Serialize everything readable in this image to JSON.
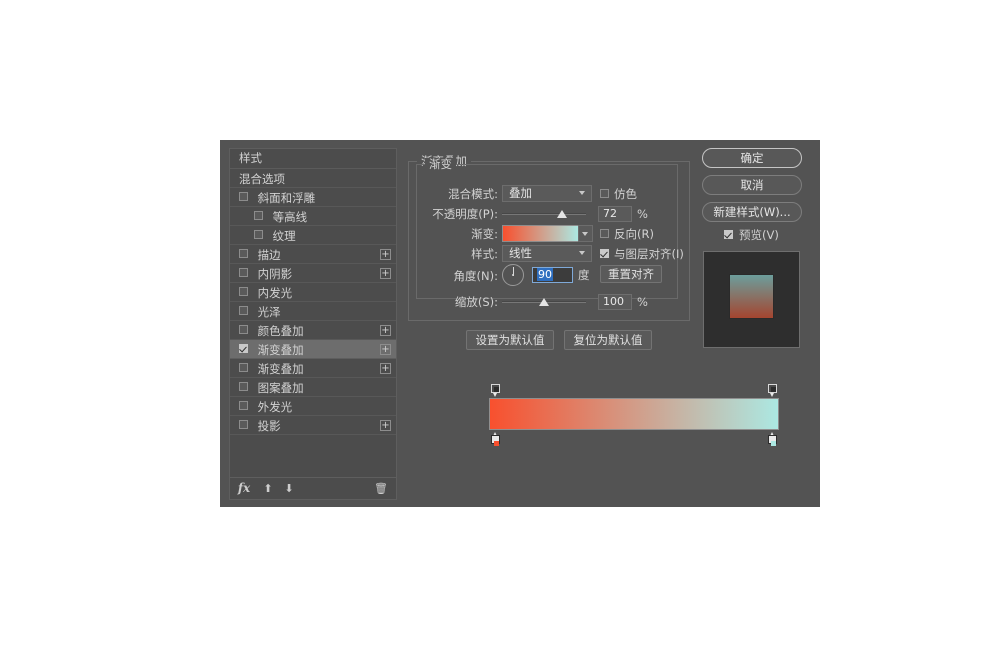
{
  "dialog": {
    "styles_panel": {
      "header": "样式",
      "blend_options": "混合选项",
      "items": [
        {
          "label": "斜面和浮雕",
          "checked": false,
          "indent": false,
          "plus": false,
          "selected": false
        },
        {
          "label": "等高线",
          "checked": false,
          "indent": true,
          "plus": false,
          "selected": false
        },
        {
          "label": "纹理",
          "checked": false,
          "indent": true,
          "plus": false,
          "selected": false
        },
        {
          "label": "描边",
          "checked": false,
          "indent": false,
          "plus": true,
          "selected": false
        },
        {
          "label": "内阴影",
          "checked": false,
          "indent": false,
          "plus": true,
          "selected": false
        },
        {
          "label": "内发光",
          "checked": false,
          "indent": false,
          "plus": false,
          "selected": false
        },
        {
          "label": "光泽",
          "checked": false,
          "indent": false,
          "plus": false,
          "selected": false
        },
        {
          "label": "颜色叠加",
          "checked": false,
          "indent": false,
          "plus": true,
          "selected": false
        },
        {
          "label": "渐变叠加",
          "checked": true,
          "indent": false,
          "plus": true,
          "selected": true
        },
        {
          "label": "渐变叠加",
          "checked": false,
          "indent": false,
          "plus": true,
          "selected": false
        },
        {
          "label": "图案叠加",
          "checked": false,
          "indent": false,
          "plus": false,
          "selected": false
        },
        {
          "label": "外发光",
          "checked": false,
          "indent": false,
          "plus": false,
          "selected": false
        },
        {
          "label": "投影",
          "checked": false,
          "indent": false,
          "plus": true,
          "selected": false
        }
      ],
      "toolbar": {
        "fx_icon": "fx-icon",
        "up_icon": "arrow-up-icon",
        "down_icon": "arrow-down-icon",
        "trash_icon": "trash-icon",
        "up_glyph": "⬆",
        "down_glyph": "⬇",
        "trash_glyph": "🗑",
        "fx_label": "fx"
      }
    },
    "main_panel": {
      "section_title": "渐变叠加",
      "group_title": "渐变",
      "blend_mode": {
        "label": "混合模式:",
        "value": "叠加"
      },
      "dither": {
        "label": "仿色",
        "checked": false
      },
      "opacity": {
        "label": "不透明度(P):",
        "value": "72",
        "unit": "%",
        "percent": 72
      },
      "gradient": {
        "label": "渐变:"
      },
      "reverse": {
        "label": "反向(R)",
        "checked": false
      },
      "style": {
        "label": "样式:",
        "value": "线性"
      },
      "align_with_layer": {
        "label": "与图层对齐(I)",
        "checked": true
      },
      "angle": {
        "label": "角度(N):",
        "value": "90",
        "unit": "度",
        "degrees": 90
      },
      "reset_align_button": "重置对齐",
      "scale": {
        "label": "缩放(S):",
        "value": "100",
        "unit": "%",
        "percent": 100
      },
      "set_default_button": "设置为默认值",
      "reset_default_button": "复位为默认值"
    },
    "right_column": {
      "ok_button": "确定",
      "cancel_button": "取消",
      "new_style_button": "新建样式(W)...",
      "preview": {
        "label": "预览(V)",
        "checked": true
      }
    },
    "gradient_editor": {
      "stops": [
        {
          "position": 0,
          "color": "#F8502E",
          "name": "gradient-stop-left"
        },
        {
          "position": 100,
          "color": "#ACE8E2",
          "name": "gradient-stop-right"
        }
      ],
      "opacity_stops": [
        {
          "position": 0,
          "name": "opacity-stop-left"
        },
        {
          "position": 100,
          "name": "opacity-stop-right"
        }
      ]
    },
    "colors": {
      "dialog_background": "#535353",
      "panel_background": "#4c4c4c",
      "selected_row": "#6d6d6d",
      "text": "#d2d2d2",
      "gradient_start": "#F8502E",
      "gradient_end": "#ACE8E2",
      "preview_top": "#6C9E9C",
      "preview_bottom": "#A4452F",
      "focus_accent": "#2f6fc0"
    }
  }
}
